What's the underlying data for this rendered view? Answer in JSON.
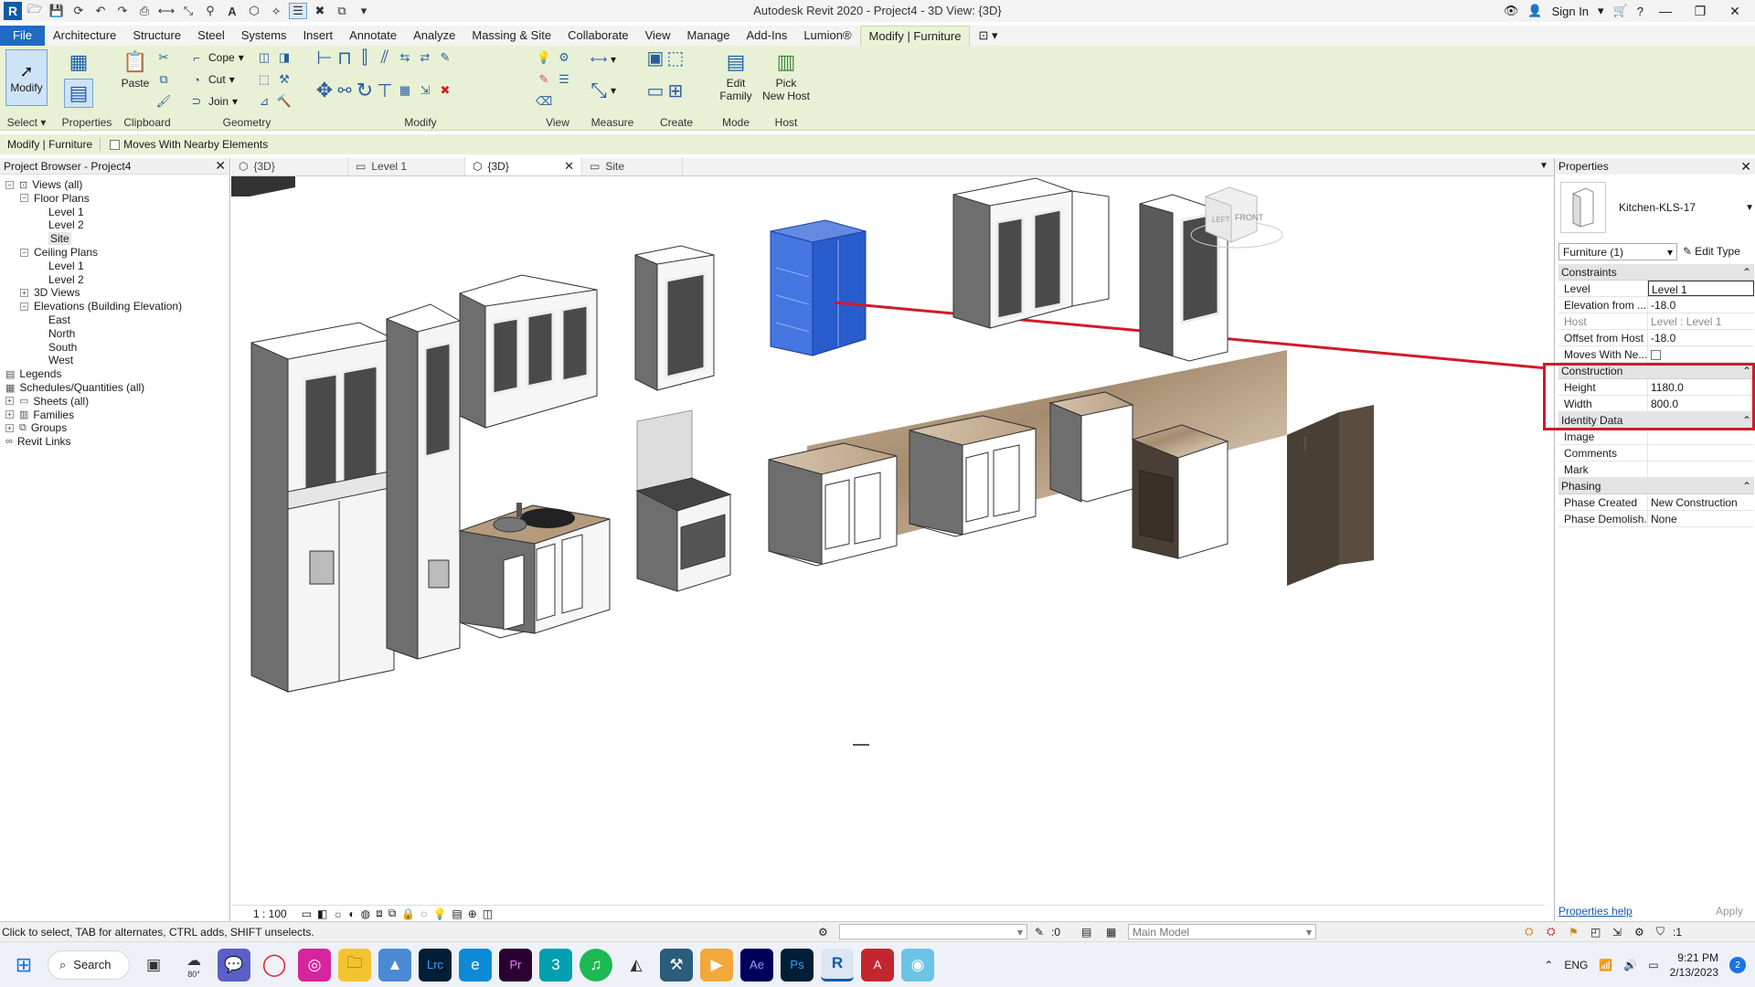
{
  "window": {
    "title": "Autodesk Revit 2020 - Project4 - 3D View: {3D}",
    "sign_in": "Sign In"
  },
  "menu": {
    "tabs": [
      "File",
      "Architecture",
      "Structure",
      "Steel",
      "Systems",
      "Insert",
      "Annotate",
      "Analyze",
      "Massing & Site",
      "Collaborate",
      "View",
      "Manage",
      "Add-Ins",
      "Lumion®",
      "Modify | Furniture"
    ],
    "active": "Modify | Furniture"
  },
  "ribbon": {
    "modify": "Modify",
    "select": "Select",
    "properties": "Properties",
    "clipboard": "Clipboard",
    "paste": "Paste",
    "cope": "Cope",
    "cut": "Cut",
    "join": "Join",
    "geometry": "Geometry",
    "modify_panel": "Modify",
    "view": "View",
    "measure": "Measure",
    "create": "Create",
    "edit_family_1": "Edit",
    "edit_family_2": "Family",
    "mode": "Mode",
    "pick_host_1": "Pick",
    "pick_host_2": "New Host",
    "host": "Host"
  },
  "options_bar": {
    "context": "Modify | Furniture",
    "moves_with": "Moves With Nearby Elements"
  },
  "project_browser": {
    "title": "Project Browser - Project4",
    "nodes": [
      {
        "label": "Views (all)",
        "level": 0,
        "exp": "−",
        "icon": "views"
      },
      {
        "label": "Floor Plans",
        "level": 1,
        "exp": "−"
      },
      {
        "label": "Level 1",
        "level": 2
      },
      {
        "label": "Level 2",
        "level": 2
      },
      {
        "label": "Site",
        "level": 2,
        "selected": true
      },
      {
        "label": "Ceiling Plans",
        "level": 1,
        "exp": "−"
      },
      {
        "label": "Level 1",
        "level": 2
      },
      {
        "label": "Level 2",
        "level": 2
      },
      {
        "label": "3D Views",
        "level": 1,
        "exp": "+"
      },
      {
        "label": "Elevations (Building Elevation)",
        "level": 1,
        "exp": "−"
      },
      {
        "label": "East",
        "level": 2
      },
      {
        "label": "North",
        "level": 2
      },
      {
        "label": "South",
        "level": 2
      },
      {
        "label": "West",
        "level": 2
      },
      {
        "label": "Legends",
        "level": 0,
        "icon": "legend"
      },
      {
        "label": "Schedules/Quantities (all)",
        "level": 0,
        "icon": "schedule"
      },
      {
        "label": "Sheets (all)",
        "level": 0,
        "exp": "+",
        "icon": "sheet"
      },
      {
        "label": "Families",
        "level": 0,
        "exp": "+",
        "icon": "family"
      },
      {
        "label": "Groups",
        "level": 0,
        "exp": "+",
        "icon": "group"
      },
      {
        "label": "Revit Links",
        "level": 0,
        "icon": "link"
      }
    ]
  },
  "view_tabs": [
    {
      "label": "{3D}"
    },
    {
      "label": "Level 1"
    },
    {
      "label": "{3D}",
      "active": true
    },
    {
      "label": "Site"
    }
  ],
  "view_scale": "1 : 100",
  "viewcube": {
    "left": "LEFT",
    "front": "FRONT"
  },
  "properties": {
    "title": "Properties",
    "type_name": "Kitchen-KLS-17",
    "instance_filter": "Furniture (1)",
    "edit_type": "Edit Type",
    "groups": [
      {
        "name": "Constraints",
        "rows": [
          {
            "k": "Level",
            "v": "Level 1",
            "boxed": true
          },
          {
            "k": "Elevation from ...",
            "v": "-18.0"
          },
          {
            "k": "Host",
            "v": "Level : Level 1",
            "dim": true
          },
          {
            "k": "Offset from Host",
            "v": "-18.0"
          },
          {
            "k": "Moves With Ne...",
            "v": "",
            "check": true
          }
        ]
      },
      {
        "name": "Construction",
        "rows": [
          {
            "k": "Height",
            "v": "1180.0"
          },
          {
            "k": "Width",
            "v": "800.0"
          }
        ]
      },
      {
        "name": "Identity Data",
        "rows": [
          {
            "k": "Image",
            "v": ""
          },
          {
            "k": "Comments",
            "v": ""
          },
          {
            "k": "Mark",
            "v": ""
          }
        ]
      },
      {
        "name": "Phasing",
        "rows": [
          {
            "k": "Phase Created",
            "v": "New Construction"
          },
          {
            "k": "Phase Demolish...",
            "v": "None"
          }
        ]
      }
    ],
    "help": "Properties help",
    "apply": "Apply"
  },
  "status": {
    "hint": "Click to select, TAB for alternates, CTRL adds, SHIFT unselects.",
    "workset": ":0",
    "model": "Main Model",
    "filter": ":1"
  },
  "taskbar": {
    "search": "Search",
    "weather": "80°",
    "lang": "ENG",
    "time": "9:21 PM",
    "date": "2/13/2023",
    "badge": "2"
  },
  "colors": {
    "ribbon": "#e8f1d6",
    "selection": "#2d63d6",
    "highlight": "#d11a2a",
    "file_tab": "#1f6bbf"
  }
}
